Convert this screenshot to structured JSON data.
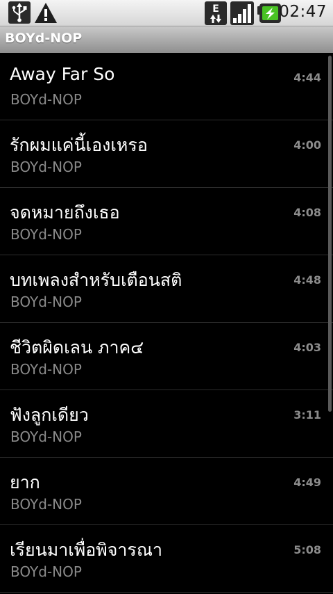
{
  "status_bar": {
    "time": "02:47",
    "network_type": "E",
    "icons": [
      "usb-icon",
      "warning-icon",
      "edge-data-icon",
      "signal-icon",
      "battery-charging-icon"
    ]
  },
  "header": {
    "title": "BOYd-NOP"
  },
  "songs": [
    {
      "title": "Away Far So",
      "artist": "BOYd-NOP",
      "duration": "4:44"
    },
    {
      "title": "รักผมแค่นี้เองเหรอ",
      "artist": "BOYd-NOP",
      "duration": "4:00"
    },
    {
      "title": "จดหมายถึงเธอ",
      "artist": "BOYd-NOP",
      "duration": "4:08"
    },
    {
      "title": "บทเพลงสำหรับเตือนสติ",
      "artist": "BOYd-NOP",
      "duration": "4:48"
    },
    {
      "title": "ชีวิตผิดเลน ภาค๔",
      "artist": "BOYd-NOP",
      "duration": "4:03"
    },
    {
      "title": "ฟังลูกเดียว",
      "artist": "BOYd-NOP",
      "duration": "3:11"
    },
    {
      "title": "ยาก",
      "artist": "BOYd-NOP",
      "duration": "4:49"
    },
    {
      "title": "เรียนมาเพื่อพิจารณา",
      "artist": "BOYd-NOP",
      "duration": "5:08"
    }
  ]
}
